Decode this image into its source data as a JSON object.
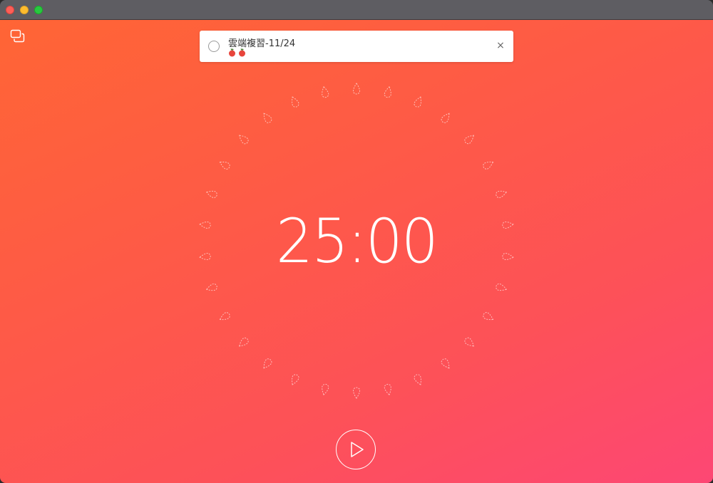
{
  "window": {
    "controls": [
      "close",
      "minimize",
      "maximize"
    ]
  },
  "sidebar_toggle": {
    "icon": "windows-icon"
  },
  "task": {
    "title": "雲端複習-11/24",
    "pomodoro_count": 2,
    "pomodoro_icon": "tomato-icon",
    "close_icon": "close-icon",
    "close_glyph": "×"
  },
  "timer": {
    "display": "25:00",
    "total_segments": 30,
    "completed_segments": 0
  },
  "play_button": {
    "icon": "play-icon"
  },
  "colors": {
    "gradient_start": "#ff6535",
    "gradient_end": "#fd4774",
    "card_background": "#ffffff",
    "text": "#ffffff",
    "tomato": "#e8453c"
  }
}
